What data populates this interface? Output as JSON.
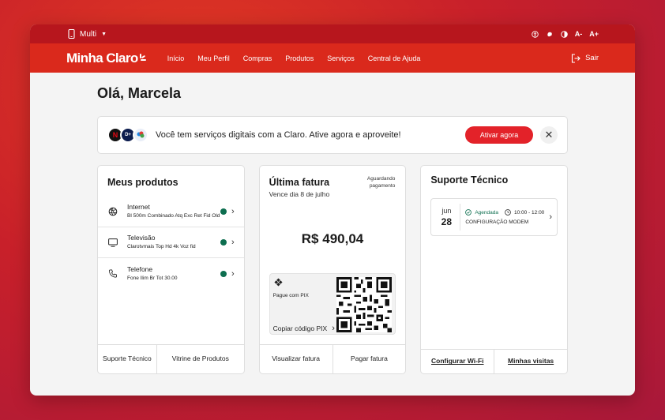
{
  "topbar": {
    "account": "Multi"
  },
  "nav": {
    "logo": "Minha Claro",
    "items": [
      "Início",
      "Meu Perfil",
      "Compras",
      "Produtos",
      "Serviços",
      "Central de Ajuda"
    ],
    "exit": "Sair"
  },
  "greeting": "Olá, Marcela",
  "banner": {
    "message": "Você tem serviços digitais com a Claro. Ative agora e aproveite!",
    "button": "Ativar agora",
    "close": "✕"
  },
  "products": {
    "title": "Meus produtos",
    "items": [
      {
        "name": "Internet",
        "detail": "Bl 500m Combinado Atq Exc Ret Fid Old"
      },
      {
        "name": "Televisão",
        "detail": "Clarotvmais Top Hd 4k Voz fid"
      },
      {
        "name": "Telefone",
        "detail": "Fone Ilim Br Tot 30.00"
      }
    ],
    "footer": [
      "Suporte Técnico",
      "Vitrine de Produtos"
    ]
  },
  "invoice": {
    "title": "Última fatura",
    "status": "Aguardando pagamento",
    "due": "Vence dia 8 de julho",
    "amount": "R$ 490,04",
    "pix_label": "Pague com PIX",
    "copy_label": "Copiar código PIX",
    "footer": [
      "Visualizar fatura",
      "Pagar fatura"
    ]
  },
  "support": {
    "title": "Suporte Técnico",
    "month": "jun",
    "day": "28",
    "status": "Agendada",
    "time": "10:00 - 12:00",
    "service": "CONFIGURAÇÃO MODEM",
    "footer": [
      "Configurar Wi-Fi",
      "Minhas visitas"
    ]
  },
  "colors": {
    "brand_red": "#da291c",
    "top_red": "#b7161d",
    "status_green": "#0d6e4f"
  }
}
